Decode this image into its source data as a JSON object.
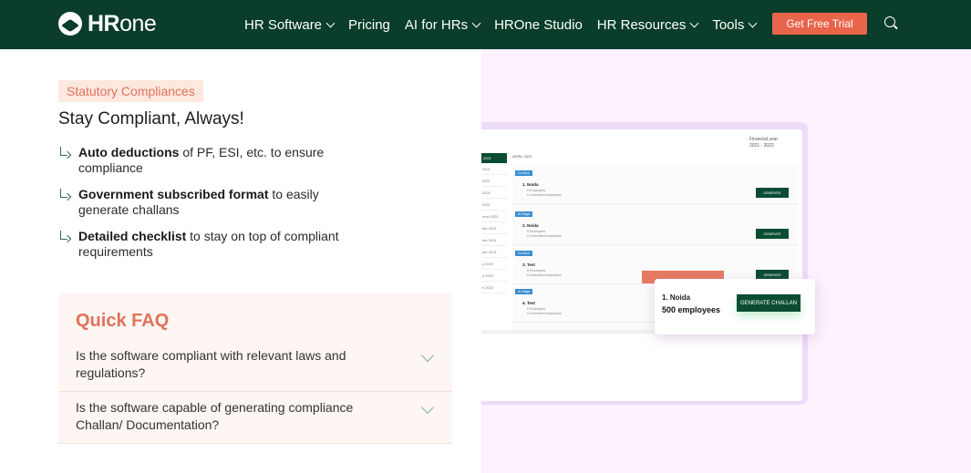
{
  "nav": {
    "logo_bold": "HR",
    "logo_light": "one",
    "items": [
      {
        "label": "HR Software",
        "dropdown": true
      },
      {
        "label": "Pricing",
        "dropdown": false
      },
      {
        "label": "AI for HRs",
        "dropdown": true
      },
      {
        "label": "HROne Studio",
        "dropdown": false
      },
      {
        "label": "HR Resources",
        "dropdown": true
      },
      {
        "label": "Tools",
        "dropdown": true
      }
    ],
    "cta": "Get Free Trial",
    "search_icon": "search-icon"
  },
  "section": {
    "tag": "Statutory Compliances",
    "heading": "Stay Compliant, Always!",
    "features": [
      {
        "bold": "Auto deductions",
        "rest": " of PF, ESI, etc. to ensure compliance"
      },
      {
        "bold": "Government subscribed format",
        "rest": " to easily generate challans"
      },
      {
        "bold": "Detailed checklist",
        "rest": " to stay on top of compliant requirements"
      }
    ]
  },
  "faq": {
    "title": "Quick FAQ",
    "items": [
      {
        "question": "Is the software compliant with relevant laws and regulations?"
      },
      {
        "question": "Is the software capable of generating compliance Challan/ Documentation?"
      }
    ]
  },
  "illustration": {
    "financial_year_label": "Financial year",
    "financial_year": "2021 - 2022",
    "month_label": "APRIL 2022",
    "side_months": [
      "2021",
      "2021",
      "2021",
      "2021",
      "2021",
      "mon 2021",
      "ber 2021",
      "ber 2021",
      "ber 2021",
      "y 2022",
      "y 2022",
      "h 2022"
    ],
    "rows": [
      {
        "due": "Go Now",
        "name": "1.  Noida",
        "line1": "8 Employees",
        "line2": "0 Unenrolled employees",
        "button": "GENERATE"
      },
      {
        "due": "At Stage",
        "name": "2.  Noida",
        "line1": "8 Employees",
        "line2": "0 Unenrolled employees",
        "button": "GENERATE"
      },
      {
        "due": "Go Now",
        "name": "3.  Test",
        "line1": "8 Employees",
        "line2": "0 Unenrolled employees",
        "button": "GENERATE"
      },
      {
        "due": "At Stage",
        "name": "4.  Test",
        "line1": "8 Employees",
        "line2": "0 Unenrolled employees",
        "button": ""
      }
    ],
    "popup": {
      "name": "1.  Noida",
      "employees": "500 employees",
      "button": "GENERATE CHALLAN"
    }
  }
}
